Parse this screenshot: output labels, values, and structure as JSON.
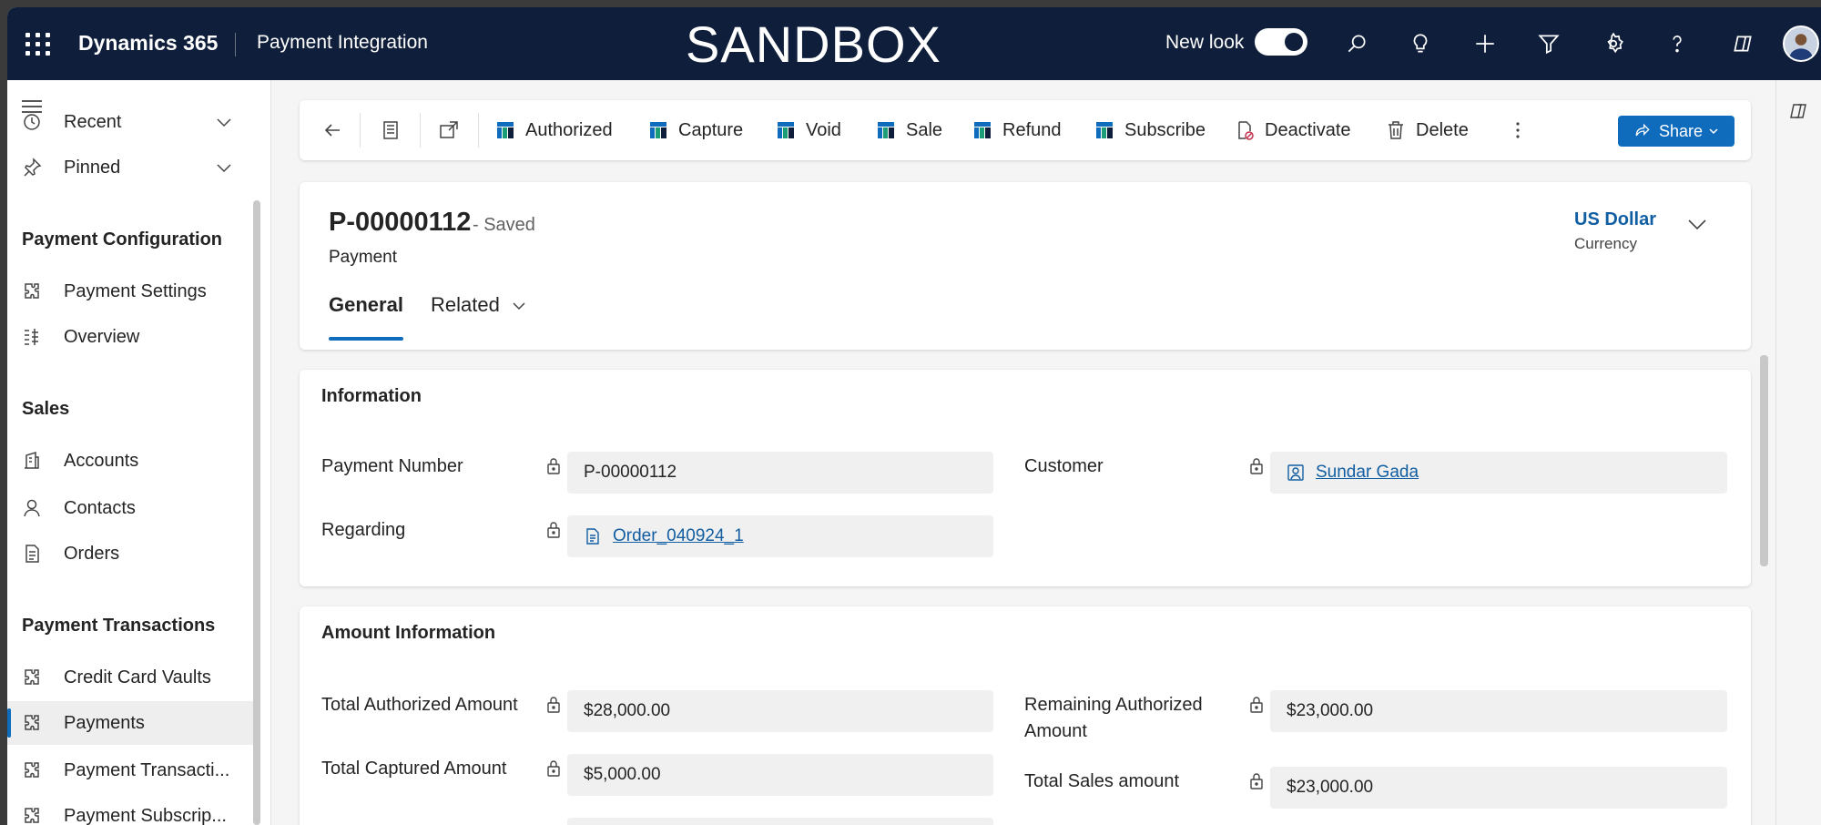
{
  "topbar": {
    "app_name": "Dynamics 365",
    "module_name": "Payment Integration",
    "environment_banner": "SANDBOX",
    "new_look_label": "New look",
    "new_look_on": true,
    "icons": [
      "search-icon",
      "lightbulb-icon",
      "plus-icon",
      "filter-icon",
      "settings-icon",
      "help-icon",
      "copilot-icon"
    ]
  },
  "leftnav": {
    "items_top": [
      {
        "label": "Recent",
        "icon": "clock-icon"
      },
      {
        "label": "Pinned",
        "icon": "pin-icon"
      }
    ],
    "groups": [
      {
        "title": "Payment Configuration",
        "items": [
          {
            "label": "Payment Settings",
            "icon": "puzzle-icon"
          },
          {
            "label": "Overview",
            "icon": "overview-icon"
          }
        ]
      },
      {
        "title": "Sales",
        "items": [
          {
            "label": "Accounts",
            "icon": "account-icon"
          },
          {
            "label": "Contacts",
            "icon": "person-icon"
          },
          {
            "label": "Orders",
            "icon": "document-icon"
          }
        ]
      },
      {
        "title": "Payment Transactions",
        "items": [
          {
            "label": "Credit Card Vaults",
            "icon": "puzzle-icon"
          },
          {
            "label": "Payments",
            "icon": "puzzle-icon",
            "active": true
          },
          {
            "label": "Payment Transacti...",
            "icon": "puzzle-icon"
          },
          {
            "label": "Payment Subscrip...",
            "icon": "puzzle-icon"
          }
        ]
      }
    ]
  },
  "commandbar": {
    "buttons": [
      "Authorized",
      "Capture",
      "Void",
      "Sale",
      "Refund",
      "Subscribe",
      "Deactivate",
      "Delete"
    ],
    "share_label": "Share"
  },
  "record": {
    "title": "P-00000112",
    "status": "- Saved",
    "entity": "Payment",
    "currency_value": "US Dollar",
    "currency_label": "Currency",
    "tabs": [
      "General",
      "Related"
    ]
  },
  "information": {
    "title": "Information",
    "payment_number_label": "Payment Number",
    "payment_number_value": "P-00000112",
    "customer_label": "Customer",
    "customer_value": "Sundar Gada",
    "regarding_label": "Regarding",
    "regarding_value": "Order_040924_1"
  },
  "amounts": {
    "title": "Amount Information",
    "total_authorized_label": "Total Authorized Amount",
    "total_authorized_value": "$28,000.00",
    "remaining_authorized_label_1": "Remaining Authorized",
    "remaining_authorized_label_2": "Amount",
    "remaining_authorized_value": "$23,000.00",
    "total_captured_label": "Total Captured Amount",
    "total_captured_value": "$5,000.00",
    "total_sales_label": "Total Sales amount",
    "total_sales_value": "$23,000.00"
  },
  "colors": {
    "topbar": "#0f1e3a",
    "accent": "#0f6cbd",
    "link": "#115ea3"
  }
}
